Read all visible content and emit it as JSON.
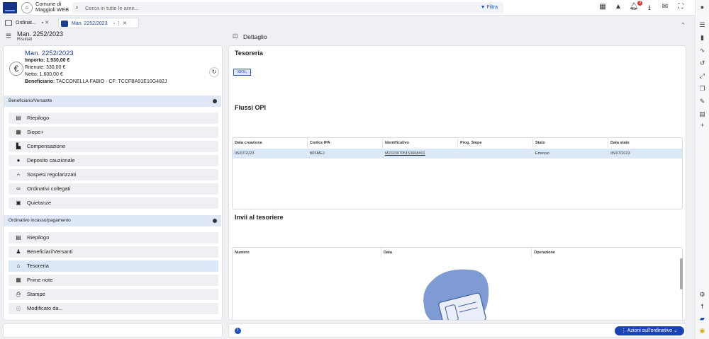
{
  "app": {
    "title_line1": "Comune di",
    "title_line2": "Maggioli WEB"
  },
  "search": {
    "placeholder": "Cerca in tutte le aree...",
    "filter_label": "Filtra"
  },
  "notifications": {
    "count": "3"
  },
  "tabs": [
    {
      "label": "Ordinat...",
      "active": false
    },
    {
      "label": "Man. 2252/2023",
      "active": true
    }
  ],
  "left": {
    "title": "Man. 2252/2023",
    "subtitle": "Risultati",
    "card": {
      "title": "Man. 2252/2023",
      "importo": "Importo: 1.930,00 €",
      "ritenute": "Ritenute: 330,00 €",
      "netto": "Netto: 1.600,00 €",
      "beneficiario_label": "Beneficiario",
      "beneficiario_value": ": TACCONELLA FABIO - CF: TCCFBA91E10G482J"
    },
    "section1": {
      "title": "Beneficiario/Versante",
      "items": [
        "Riepilogo",
        "Siope+",
        "Compensazione",
        "Deposito cauzionale",
        "Sospesi regolarizzati",
        "Ordinativi collegati",
        "Quietanze"
      ]
    },
    "section2": {
      "title": "Ordinativo incasso/pagamento",
      "items": [
        "Riepilogo",
        "Beneficiari/Versanti",
        "Tesoreria",
        "Prime note",
        "Stampe",
        "Modificato da..."
      ]
    }
  },
  "right": {
    "header": "Dettaglio",
    "tesoreria_title": "Tesoreria",
    "tesoreria_logo": "SIOL",
    "flussi_title": "Flussi OPI",
    "flussi_table": {
      "headers": [
        "Data creazione",
        "Codice IPA",
        "Identificativo",
        "Prog. Siope",
        "Stato",
        "Data stato"
      ],
      "rows": [
        [
          "05/07/2023",
          "80SMEJ",
          "M20230705153608#01",
          "",
          "Emesso",
          "05/07/2023"
        ]
      ]
    },
    "invii_title": "Invii al tesoriere",
    "invii_table": {
      "headers": [
        "Numero",
        "Data",
        "Operazione"
      ]
    },
    "azioni_label": "Azioni sull'ordinativo"
  },
  "colors": {
    "primary": "#1c43b5",
    "section_bg": "#dfe8f7",
    "selected_row": "#dbe8f7"
  }
}
